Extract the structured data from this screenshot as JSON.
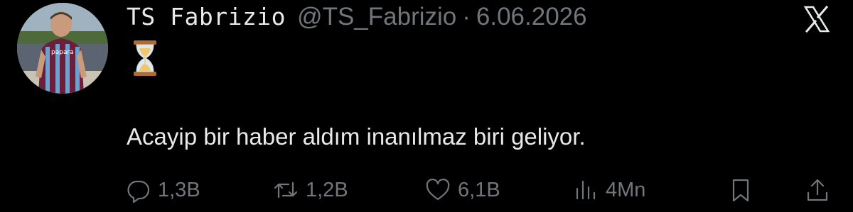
{
  "tweet": {
    "display_name": "TS Fabrizio",
    "handle": "@TS_Fabrizio",
    "separator": "·",
    "date": "6.06.2026",
    "emoji": "⌛",
    "text": "Acayip bir haber aldım inanılmaz biri geliyor.",
    "avatar_shirt_text": "papara"
  },
  "actions": {
    "replies": "1,3B",
    "retweets": "1,2B",
    "likes": "6,1B",
    "views": "4Mn"
  },
  "icons": {
    "logo": "x-logo-icon",
    "reply": "reply-icon",
    "retweet": "retweet-icon",
    "like": "heart-icon",
    "views": "analytics-icon",
    "bookmark": "bookmark-icon",
    "share": "share-icon"
  },
  "colors": {
    "background": "#000000",
    "primary_text": "#e7e9ea",
    "secondary_text": "#71767b"
  }
}
